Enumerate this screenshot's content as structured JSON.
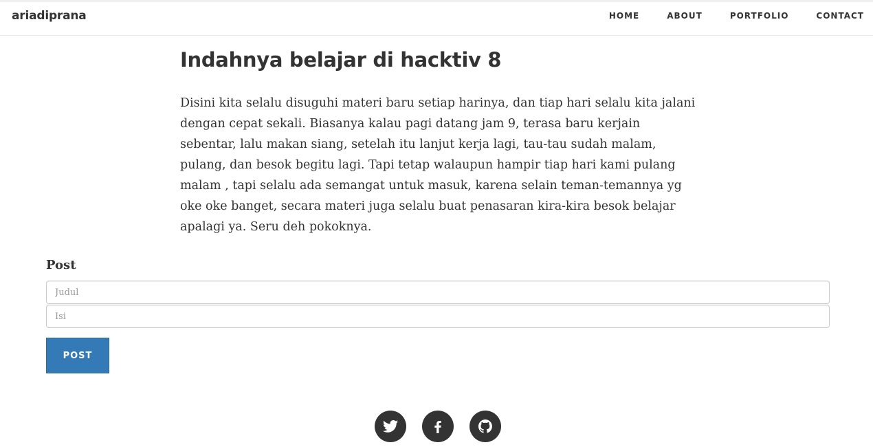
{
  "navbar": {
    "brand": "ariadiprana",
    "links": [
      "HOME",
      "ABOUT",
      "PORTFOLIO",
      "CONTACT"
    ]
  },
  "article": {
    "title": "Indahnya belajar di hacktiv 8",
    "body": "Disini kita selalu disuguhi materi baru setiap harinya, dan tiap hari selalu kita jalani dengan cepat sekali. Biasanya kalau pagi datang jam 9, terasa baru kerjain sebentar, lalu makan siang, setelah itu lanjut kerja lagi, tau-tau sudah malam, pulang, dan besok begitu lagi. Tapi tetap walaupun hampir tiap hari kami pulang malam , tapi selalu ada semangat untuk masuk, karena selain teman-temannya yg oke oke banget, secara materi juga selalu buat penasaran kira-kira besok belajar apalagi ya. Seru deh pokoknya."
  },
  "form": {
    "heading": "Post",
    "title_placeholder": "Judul",
    "title_value": "",
    "content_placeholder": "Isi",
    "content_value": "",
    "submit_label": "POST"
  },
  "social": {
    "icons": [
      "twitter-icon",
      "facebook-icon",
      "github-icon"
    ]
  },
  "colors": {
    "primary_button": "#337ab7",
    "text": "#333333",
    "social_circle": "#333333"
  }
}
